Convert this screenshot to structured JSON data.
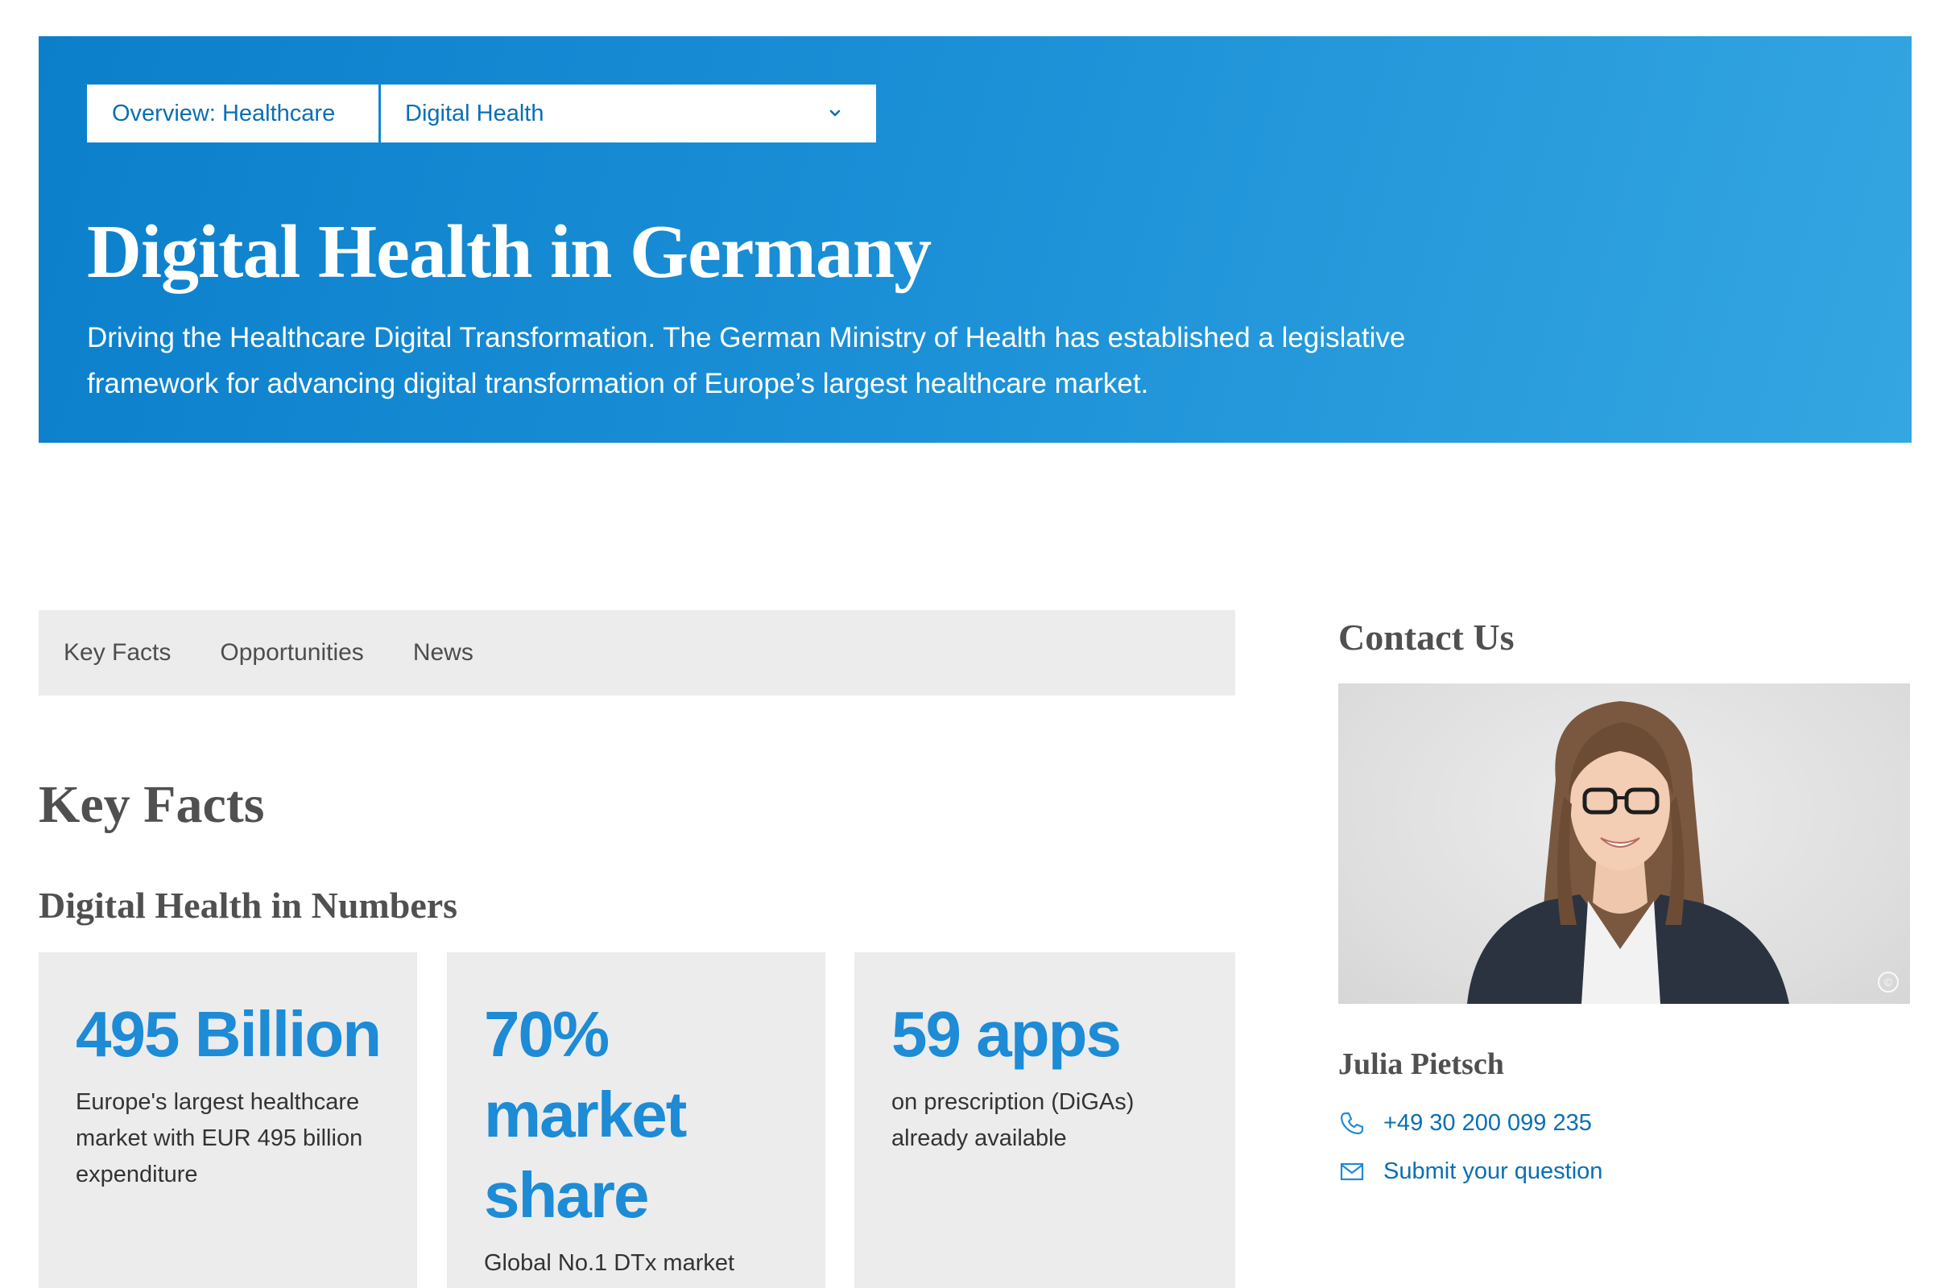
{
  "hero": {
    "breadcrumb_overview": "Overview: Healthcare",
    "breadcrumb_select": "Digital Health",
    "title": "Digital Health in Germany",
    "description": "Driving the Healthcare Digital Transformation. The German Ministry of Health has established a legislative framework for advancing digital transformation of Europe’s largest healthcare market.",
    "colors": {
      "gradient_start": "#0c7fcb",
      "gradient_end": "#34a6e1"
    }
  },
  "tabs": [
    {
      "label": "Key Facts"
    },
    {
      "label": "Opportunities"
    },
    {
      "label": "News"
    }
  ],
  "key_facts": {
    "heading": "Key Facts",
    "subheading": "Digital Health in Numbers",
    "cards": [
      {
        "value": "495 Billion",
        "text": "Europe's largest healthcare market with EUR 495 billion expenditure"
      },
      {
        "value": "70% market share",
        "text": "Global No.1 DTx market"
      },
      {
        "value": "59 apps",
        "text": "on prescription (DiGAs) already available"
      }
    ],
    "accent_color": "#1d8bd6"
  },
  "contact": {
    "title": "Contact Us",
    "name": "Julia Pietsch",
    "phone": "+49 30 200 099 235",
    "submit_label": "Submit your question",
    "icons": [
      "phone-icon",
      "mail-icon",
      "copyright-icon",
      "chevron-down-icon"
    ]
  }
}
